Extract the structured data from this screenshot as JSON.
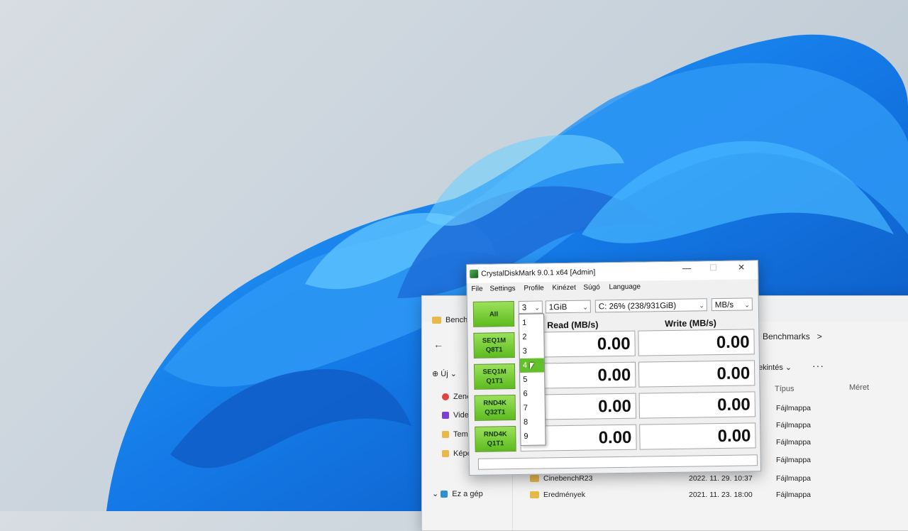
{
  "desktop": {
    "accent": "#1f7be6"
  },
  "explorer": {
    "tab_title": "Bench",
    "breadcrumb": "Benchmarks",
    "breadcrumb_arrow": ">",
    "new_label": "Új",
    "view_label": "ekintés",
    "more": "···",
    "columns": {
      "type": "Típus",
      "size": "Méret"
    },
    "sidebar": [
      "Zene",
      "Vide",
      "Tem",
      "Képe"
    ],
    "this_pc": "Ez a gép",
    "type_values": [
      "Fájlmappa",
      "Fájlmappa",
      "Fájlmappa",
      "Fájlmappa",
      "Fájlmappa",
      "Fájlmappa"
    ],
    "rows": [
      {
        "name": "CinebenchR23",
        "date": "2022. 11. 29. 10:37",
        "type": "Fájlmappa"
      },
      {
        "name": "Eredmények",
        "date": "2021. 11. 23. 18:00",
        "type": "Fájlmappa"
      }
    ]
  },
  "cdm": {
    "title": "CrystalDiskMark 9.0.1 x64 [Admin]",
    "menu": [
      "File",
      "Settings",
      "Profile",
      "Kinézet",
      "Súgó",
      "Language"
    ],
    "count_value": "3",
    "size_value": "1GiB",
    "drive_value": "C: 26% (238/931GiB)",
    "unit_value": "MB/s",
    "all_button": "All",
    "tests": [
      {
        "line1": "SEQ1M",
        "line2": "Q8T1"
      },
      {
        "line1": "SEQ1M",
        "line2": "Q1T1"
      },
      {
        "line1": "RND4K",
        "line2": "Q32T1"
      },
      {
        "line1": "RND4K",
        "line2": "Q1T1"
      }
    ],
    "read_header": "Read (MB/s)",
    "write_header": "Write (MB/s)",
    "read_values": [
      "0.00",
      "0.00",
      "0.00",
      "0.00"
    ],
    "write_values": [
      "0.00",
      "0.00",
      "0.00",
      "0.00"
    ],
    "dropdown_options": [
      "1",
      "2",
      "3",
      "4",
      "5",
      "6",
      "7",
      "8",
      "9"
    ],
    "dropdown_selected": "4",
    "accent": "#63c02b"
  }
}
